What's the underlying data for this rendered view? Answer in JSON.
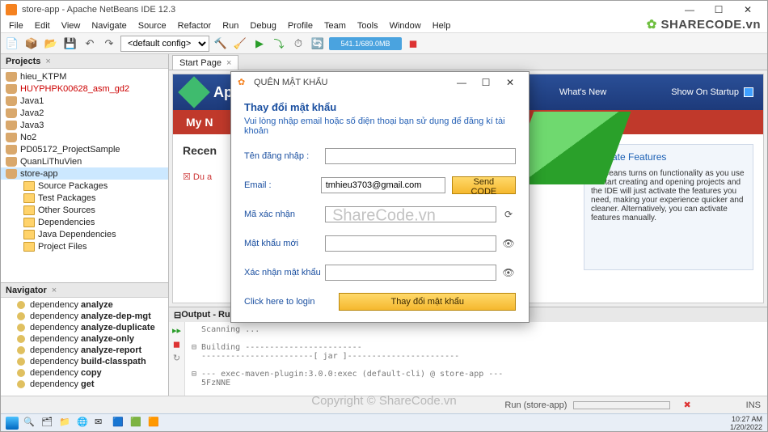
{
  "window": {
    "title": "store-app - Apache NetBeans IDE 12.3"
  },
  "menu": [
    "File",
    "Edit",
    "View",
    "Navigate",
    "Source",
    "Refactor",
    "Run",
    "Debug",
    "Profile",
    "Team",
    "Tools",
    "Window",
    "Help"
  ],
  "toolbar": {
    "config": "<default config>",
    "memory": "541.1/689.0MB"
  },
  "brand": "SHARECODE.vn",
  "projects": {
    "title": "Projects",
    "items": [
      {
        "label": "hieu_KTPM"
      },
      {
        "label": "HUYPHPK00628_asm_gd2",
        "red": true
      },
      {
        "label": "Java1"
      },
      {
        "label": "Java2"
      },
      {
        "label": "Java3"
      },
      {
        "label": "No2"
      },
      {
        "label": "PD05172_ProjectSample"
      },
      {
        "label": "QuanLiThuVien"
      },
      {
        "label": "store-app",
        "sel": true
      }
    ],
    "children": [
      "Source Packages",
      "Test Packages",
      "Other Sources",
      "Dependencies",
      "Java Dependencies",
      "Project Files"
    ]
  },
  "navigator": {
    "title": "Navigator",
    "items": [
      "dependency analyze",
      "dependency analyze-dep-mgt",
      "dependency analyze-duplicate",
      "dependency analyze-only",
      "dependency analyze-report",
      "dependency build-classpath",
      "dependency copy",
      "dependency get"
    ]
  },
  "startpage": {
    "tab": "Start Page",
    "apptitle": "Ap",
    "whatsnew": "What's New",
    "showstartup": "Show On Startup",
    "mytab": "My N",
    "recent": "Recen",
    "duerr": "Du a",
    "activate_h": "Activate Features",
    "activate_body": "NetBeans turns on functionality as you use it. Start creating and opening projects and the IDE will just activate the features you need, making your experience quicker and cleaner. Alternatively, you can activate features manually."
  },
  "output": {
    "title": "Output - Run (s",
    "lines": "  Scanning ...\n\n⊟ Building ------------------------\n  -----------------------[ jar ]-----------------------\n\n⊟ --- exec-maven-plugin:3.0.0:exec (default-cli) @ store-app ---\n  5FzNNE"
  },
  "status": {
    "run": "Run (store-app)",
    "ins": "INS"
  },
  "taskbar": {
    "time": "10:27 AM",
    "date": "1/20/2022"
  },
  "dialog": {
    "title": "QUÊN MẬT KHẨU",
    "heading": "Thay đổi mật khẩu",
    "sub": "Vui lòng nhập email hoặc số điện thoại bạn sử dụng để đăng kí tài khoản",
    "f_user": "Tên đăng nhập :",
    "f_email": "Email :",
    "email_value": "tmhieu3703@gmail.com",
    "send": "Send CODE",
    "f_code": "Mã xác nhận",
    "f_newpw": "Mật khẩu mới",
    "f_confirm": "Xác nhận mật khẩu",
    "link": "Click here to login",
    "submit": "Thay đổi mật khẩu"
  },
  "watermark1": "ShareCode.vn",
  "watermark2": "Copyright © ShareCode.vn"
}
